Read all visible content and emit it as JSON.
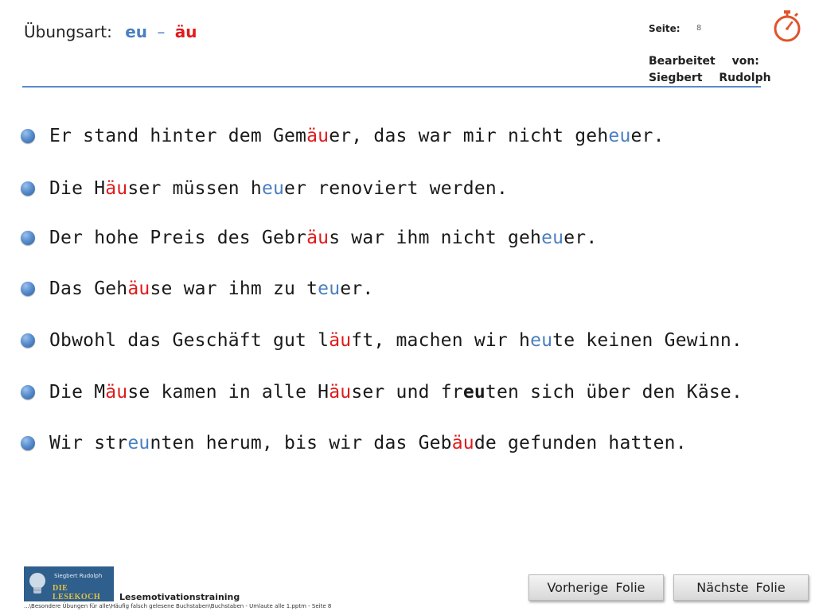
{
  "header": {
    "label": "Übungsart:",
    "eu": "eu",
    "dash": "–",
    "aeu": "äu",
    "seite_label": "Seite:",
    "seite_num": "8",
    "bearb_line1": "Bearbeitet von:",
    "bearb_line2": "Siegbert Rudolph",
    "accent_blue": "#4a7fc1",
    "accent_red": "#e01b1b"
  },
  "sentences": [
    [
      [
        "Er stand hinter dem Gem",
        ""
      ],
      [
        "äu",
        "r"
      ],
      [
        "er, das war mir nicht geh",
        ""
      ],
      [
        "eu",
        "b"
      ],
      [
        "er.",
        ""
      ]
    ],
    [
      [
        "Die H",
        ""
      ],
      [
        "äu",
        "r"
      ],
      [
        "ser müssen h",
        ""
      ],
      [
        "eu",
        "b"
      ],
      [
        "er renoviert werden.",
        ""
      ]
    ],
    [
      [
        "Der hohe Preis des Gebr",
        ""
      ],
      [
        "äu",
        "r"
      ],
      [
        "s war ihm nicht geh",
        ""
      ],
      [
        "eu",
        "b"
      ],
      [
        "er.",
        ""
      ]
    ],
    [
      [
        "Das Geh",
        ""
      ],
      [
        "äu",
        "r"
      ],
      [
        "se war ihm zu t",
        ""
      ],
      [
        "eu",
        "b"
      ],
      [
        "er.",
        ""
      ]
    ],
    [
      [
        "Obwohl das Geschäft gut l",
        ""
      ],
      [
        "äu",
        "r"
      ],
      [
        "ft, machen wir h",
        ""
      ],
      [
        "eu",
        "b"
      ],
      [
        "te keinen Gewinn.",
        ""
      ]
    ],
    [
      [
        "Die M",
        ""
      ],
      [
        "äu",
        "r"
      ],
      [
        "se kamen in alle H",
        ""
      ],
      [
        "äu",
        "r"
      ],
      [
        "ser und fr",
        ""
      ],
      [
        "eu",
        "k"
      ],
      [
        "ten sich über den Käse.",
        ""
      ]
    ],
    [
      [
        "Wir str",
        ""
      ],
      [
        "eu",
        "b"
      ],
      [
        "nten herum, bis wir das Geb",
        ""
      ],
      [
        "äu",
        "r"
      ],
      [
        "de gefunden hatten.",
        ""
      ]
    ]
  ],
  "logo": {
    "line1": "Siegbert Rudolph",
    "line2": "DIE LESEKOCH"
  },
  "footer": {
    "title": "Lesemotivationstraining",
    "path": "...\\Besondere Übungen für alle\\Häufig falsch gelesene Buchstaben\\Buchstaben - Umlaute alle 1.pptm - Seite 8"
  },
  "nav": {
    "prev": "Vorherige Folie",
    "next": "Nächste Folie"
  }
}
